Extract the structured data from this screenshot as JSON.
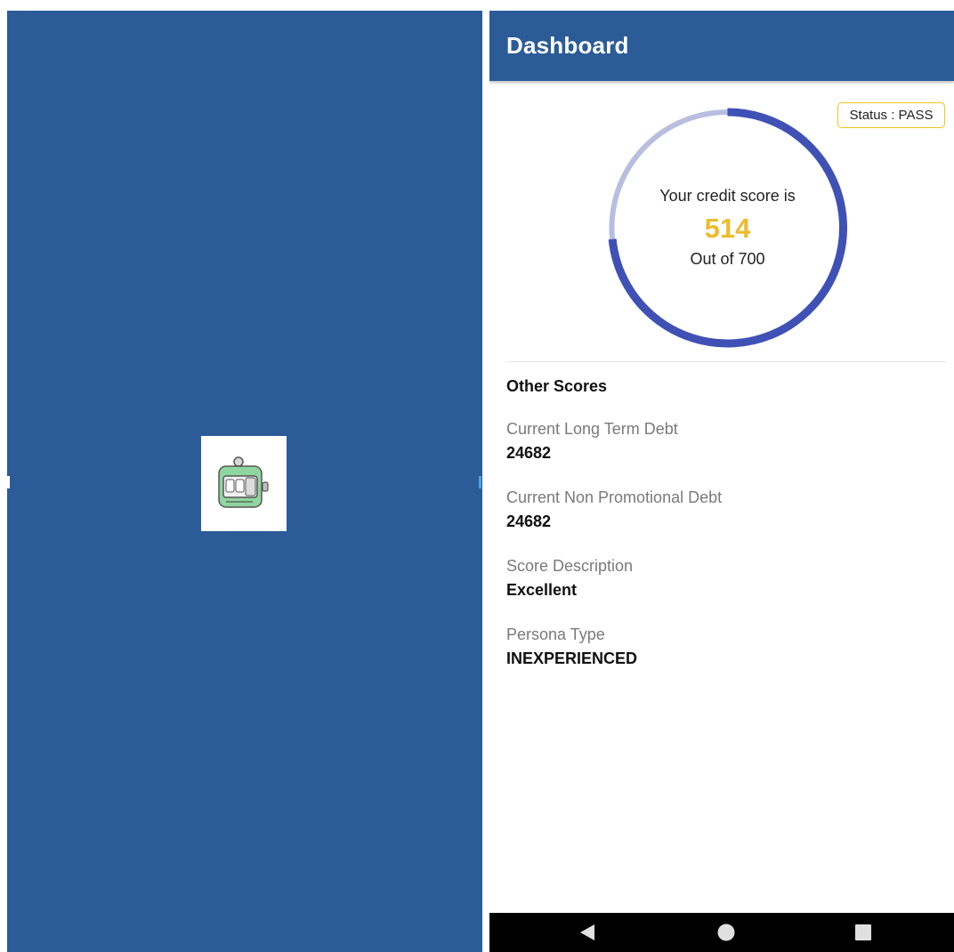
{
  "splash": {
    "background_color": "#2b5c98",
    "logo_icon": "credit-meter-icon",
    "logo_digits": "00"
  },
  "app_bar": {
    "title": "Dashboard",
    "color": "#2b5c98"
  },
  "status": {
    "label": "Status : PASS",
    "border_color": "#f0c419"
  },
  "credit_score": {
    "caption": "Your credit score is",
    "score": 514,
    "max": 700,
    "out_of_text": "Out of 700",
    "score_display": "514",
    "arc_color": "#3f51b5",
    "track_color": "#b8bedf",
    "score_color": "#ecbc2e"
  },
  "other_scores": {
    "title": "Other Scores",
    "items": [
      {
        "label": "Current Long Term Debt",
        "value": "24682"
      },
      {
        "label": "Current Non Promotional Debt",
        "value": "24682"
      },
      {
        "label": "Score Description",
        "value": "Excellent"
      },
      {
        "label": "Persona Type",
        "value": "INEXPERIENCED"
      }
    ]
  },
  "nav_bar": {
    "buttons": [
      "back-icon",
      "home-icon",
      "recents-icon"
    ]
  }
}
